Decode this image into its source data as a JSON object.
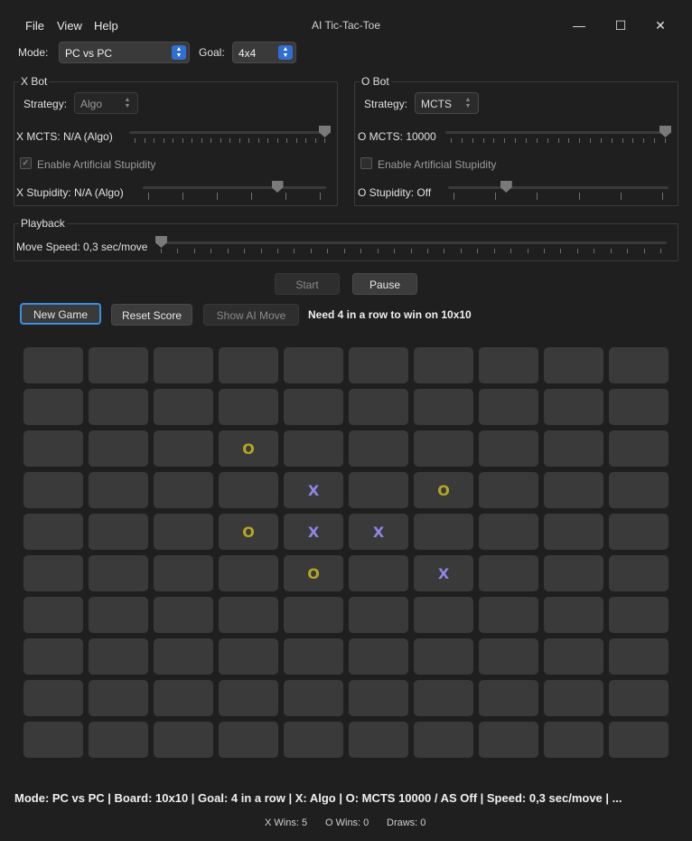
{
  "window": {
    "title": "AI Tic-Tac-Toe",
    "menu": [
      "File",
      "View",
      "Help"
    ],
    "controls": {
      "minimize": "—",
      "maximize": "☐",
      "close": "✕"
    }
  },
  "top": {
    "mode_label": "Mode:",
    "mode_value": "PC vs PC",
    "goal_label": "Goal:",
    "goal_value": "4x4"
  },
  "x_bot": {
    "title": "X Bot",
    "strategy_label": "Strategy:",
    "strategy_value": "Algo",
    "mcts_label": "X MCTS: N/A (Algo)",
    "mcts_slider_level": 1.0,
    "stupidity_checkbox_label": "Enable Artificial Stupidity",
    "stupidity_checked": true,
    "stupidity_label": "X Stupidity: N/A (Algo)",
    "stupidity_slider_level": 0.75
  },
  "o_bot": {
    "title": "O Bot",
    "strategy_label": "Strategy:",
    "strategy_value": "MCTS",
    "mcts_label": "O MCTS: 10000",
    "mcts_slider_level": 1.0,
    "stupidity_checkbox_label": "Enable Artificial Stupidity",
    "stupidity_checked": false,
    "stupidity_label": "O Stupidity: Off",
    "stupidity_slider_level": 0.25
  },
  "playback": {
    "title": "Playback",
    "speed_label": "Move Speed: 0,3 sec/move",
    "speed_slider_level": 0.0
  },
  "controls": {
    "start": "Start",
    "pause": "Pause",
    "new_game": "New Game",
    "reset_score": "Reset Score",
    "show_ai_move": "Show AI Move",
    "info": "Need 4 in a row to win on 10x10"
  },
  "board": {
    "size": 10,
    "rows": [
      [
        "",
        "",
        "",
        "",
        "",
        "",
        "",
        "",
        "",
        ""
      ],
      [
        "",
        "",
        "",
        "",
        "",
        "",
        "",
        "",
        "",
        ""
      ],
      [
        "",
        "",
        "",
        "O",
        "",
        "",
        "",
        "",
        "",
        ""
      ],
      [
        "",
        "",
        "",
        "",
        "X",
        "",
        "O",
        "",
        "",
        ""
      ],
      [
        "",
        "",
        "",
        "O",
        "X",
        "X",
        "",
        "",
        "",
        ""
      ],
      [
        "",
        "",
        "",
        "",
        "O",
        "",
        "X",
        "",
        "",
        ""
      ],
      [
        "",
        "",
        "",
        "",
        "",
        "",
        "",
        "",
        "",
        ""
      ],
      [
        "",
        "",
        "",
        "",
        "",
        "",
        "",
        "",
        "",
        ""
      ],
      [
        "",
        "",
        "",
        "",
        "",
        "",
        "",
        "",
        "",
        ""
      ],
      [
        "",
        "",
        "",
        "",
        "",
        "",
        "",
        "",
        "",
        ""
      ]
    ]
  },
  "status": {
    "line": "Mode: PC vs PC | Board: 10x10 | Goal: 4 in a row | X: Algo | O: MCTS 10000 / AS Off | Speed: 0,3 sec/move | ...",
    "x_wins": "X Wins: 5",
    "o_wins": "O Wins: 0",
    "draws": "Draws: 0"
  },
  "colors": {
    "x_mark": "#8f86e8",
    "o_mark": "#b5a623",
    "accent": "#3c8fe0"
  }
}
